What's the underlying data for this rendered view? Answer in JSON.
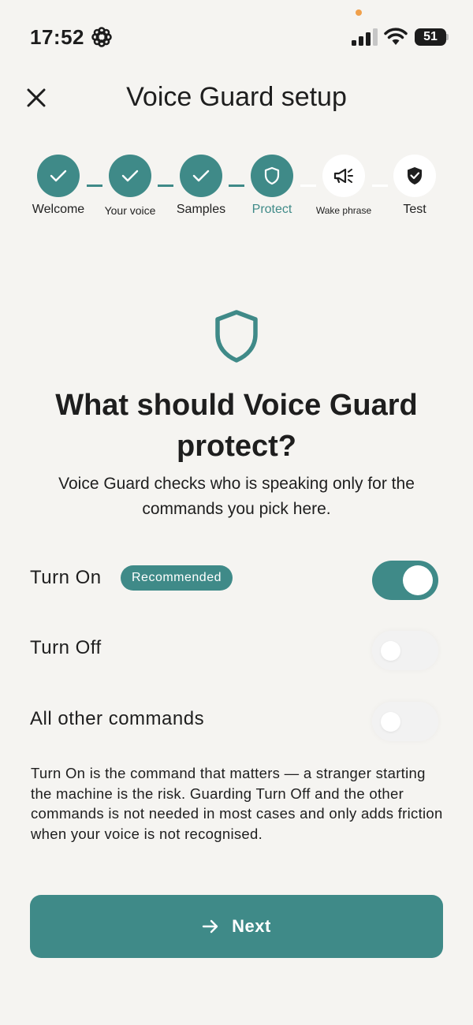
{
  "status_bar": {
    "time": "17:52",
    "battery": "51"
  },
  "header": {
    "title": "Voice Guard setup"
  },
  "stepper": {
    "steps": [
      {
        "label": "Welcome",
        "state": "done"
      },
      {
        "label": "Your voice",
        "state": "done"
      },
      {
        "label": "Samples",
        "state": "done"
      },
      {
        "label": "Protect",
        "state": "current"
      },
      {
        "label": "Wake phrase",
        "state": "todo"
      },
      {
        "label": "Test",
        "state": "todo"
      }
    ]
  },
  "main": {
    "question": "What should Voice Guard protect?",
    "subtitle": "Voice Guard checks who is speaking only for the commands you pick here.",
    "options": [
      {
        "label": "Turn On",
        "badge": "Recommended",
        "enabled": true
      },
      {
        "label": "Turn Off",
        "enabled": false
      },
      {
        "label": "All other commands",
        "enabled": false
      }
    ],
    "explainer": "Turn On is the command that matters — a stranger starting the machine is the risk. Guarding Turn Off and the other commands is not needed in most cases and only adds friction when your voice is not recognised."
  },
  "footer": {
    "next_label": "Next"
  },
  "colors": {
    "accent": "#3f8a88",
    "background": "#f5f4f1",
    "text": "#1e1e1e"
  }
}
